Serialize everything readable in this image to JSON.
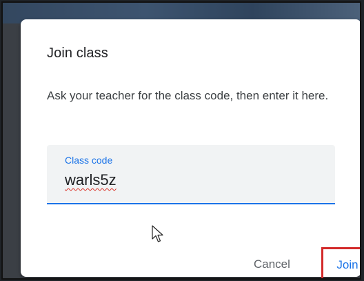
{
  "dialog": {
    "title": "Join class",
    "description": "Ask your teacher for the class code, then enter it here.",
    "field": {
      "label": "Class code",
      "value": "warls5z"
    },
    "cancel_label": "Cancel",
    "join_label": "Join"
  },
  "colors": {
    "accent": "#1a73e8",
    "highlight_box": "#d32a2a",
    "spellcheck": "#d93025"
  }
}
